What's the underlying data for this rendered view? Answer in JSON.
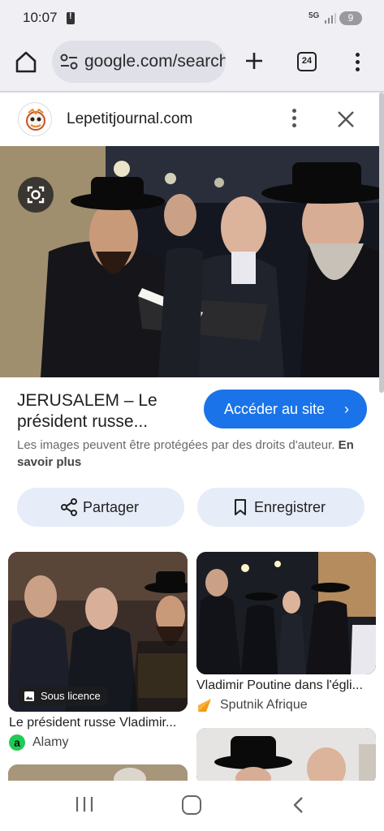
{
  "status_bar": {
    "time": "10:07",
    "network": "5G",
    "battery": "9"
  },
  "browser": {
    "url": "google.com/search",
    "tab_count": "24"
  },
  "panel": {
    "site_name": "Lepetitjournal.com",
    "title": "JERUSALEM – Le président russe...",
    "visit_label": "Accéder au site",
    "copyright_text": "Les images peuvent être protégées par des droits d'auteur.",
    "learn_more": "En savoir plus",
    "share_label": "Partager",
    "save_label": "Enregistrer"
  },
  "results": [
    {
      "title": "Le président russe Vladimir...",
      "source": "Alamy",
      "badge": "Sous licence"
    },
    {
      "title": "Vladimir Poutine dans l'égli...",
      "source": "Sputnik Afrique"
    }
  ],
  "colors": {
    "accent": "#1a73e8",
    "chip_bg": "#e6ecf8",
    "alamy": "#1ecb55",
    "sputnik": "#f59a0f"
  },
  "icons": [
    "home-icon",
    "tune-icon",
    "plus-icon",
    "tabs-icon",
    "more-vert-icon",
    "close-icon",
    "lens-icon",
    "share-icon",
    "bookmark-icon",
    "image-icon",
    "chevron-right-icon"
  ]
}
